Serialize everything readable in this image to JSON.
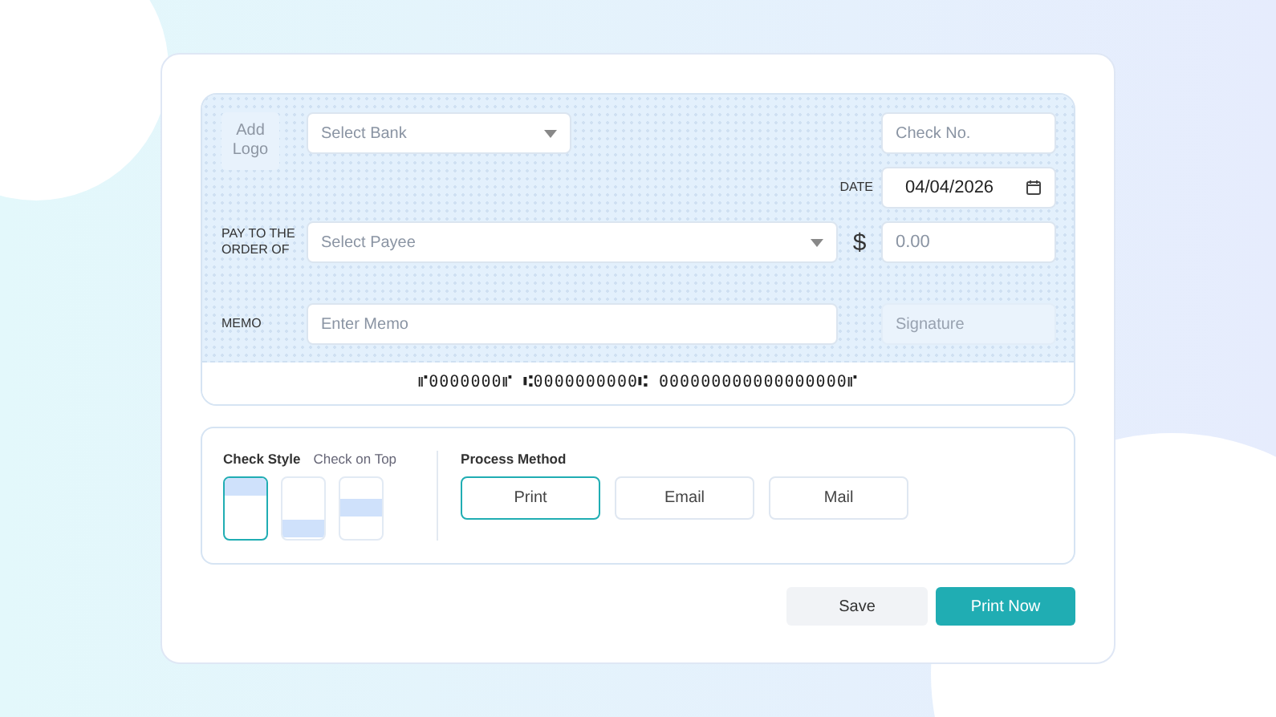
{
  "check": {
    "logo": "Add Logo",
    "bank": {
      "placeholder": "Select Bank"
    },
    "check_no": {
      "placeholder": "Check No."
    },
    "date_label": "DATE",
    "date": {
      "value": "04/04/2026"
    },
    "payee_label": "PAY TO THE ORDER OF",
    "payee": {
      "placeholder": "Select Payee"
    },
    "currency": "$",
    "amount": {
      "placeholder": "0.00"
    },
    "memo_label": "MEMO",
    "memo": {
      "placeholder": "Enter Memo"
    },
    "signature": {
      "placeholder": "Signature"
    },
    "micr_line": "⑈0000000⑈ ⑆0000000000⑆ 000000000000000000⑈"
  },
  "options": {
    "check_style_label": "Check Style",
    "check_position_label": "Check on Top",
    "styles": [
      {
        "kind": "top",
        "selected": true
      },
      {
        "kind": "bottom",
        "selected": false
      },
      {
        "kind": "middle",
        "selected": false
      }
    ],
    "process_label": "Process Method",
    "methods": [
      {
        "label": "Print",
        "selected": true
      },
      {
        "label": "Email",
        "selected": false
      },
      {
        "label": "Mail",
        "selected": false
      }
    ]
  },
  "buttons": [
    {
      "label": "Save",
      "kind": "secondary"
    },
    {
      "label": "Print Now",
      "kind": "primary"
    }
  ]
}
